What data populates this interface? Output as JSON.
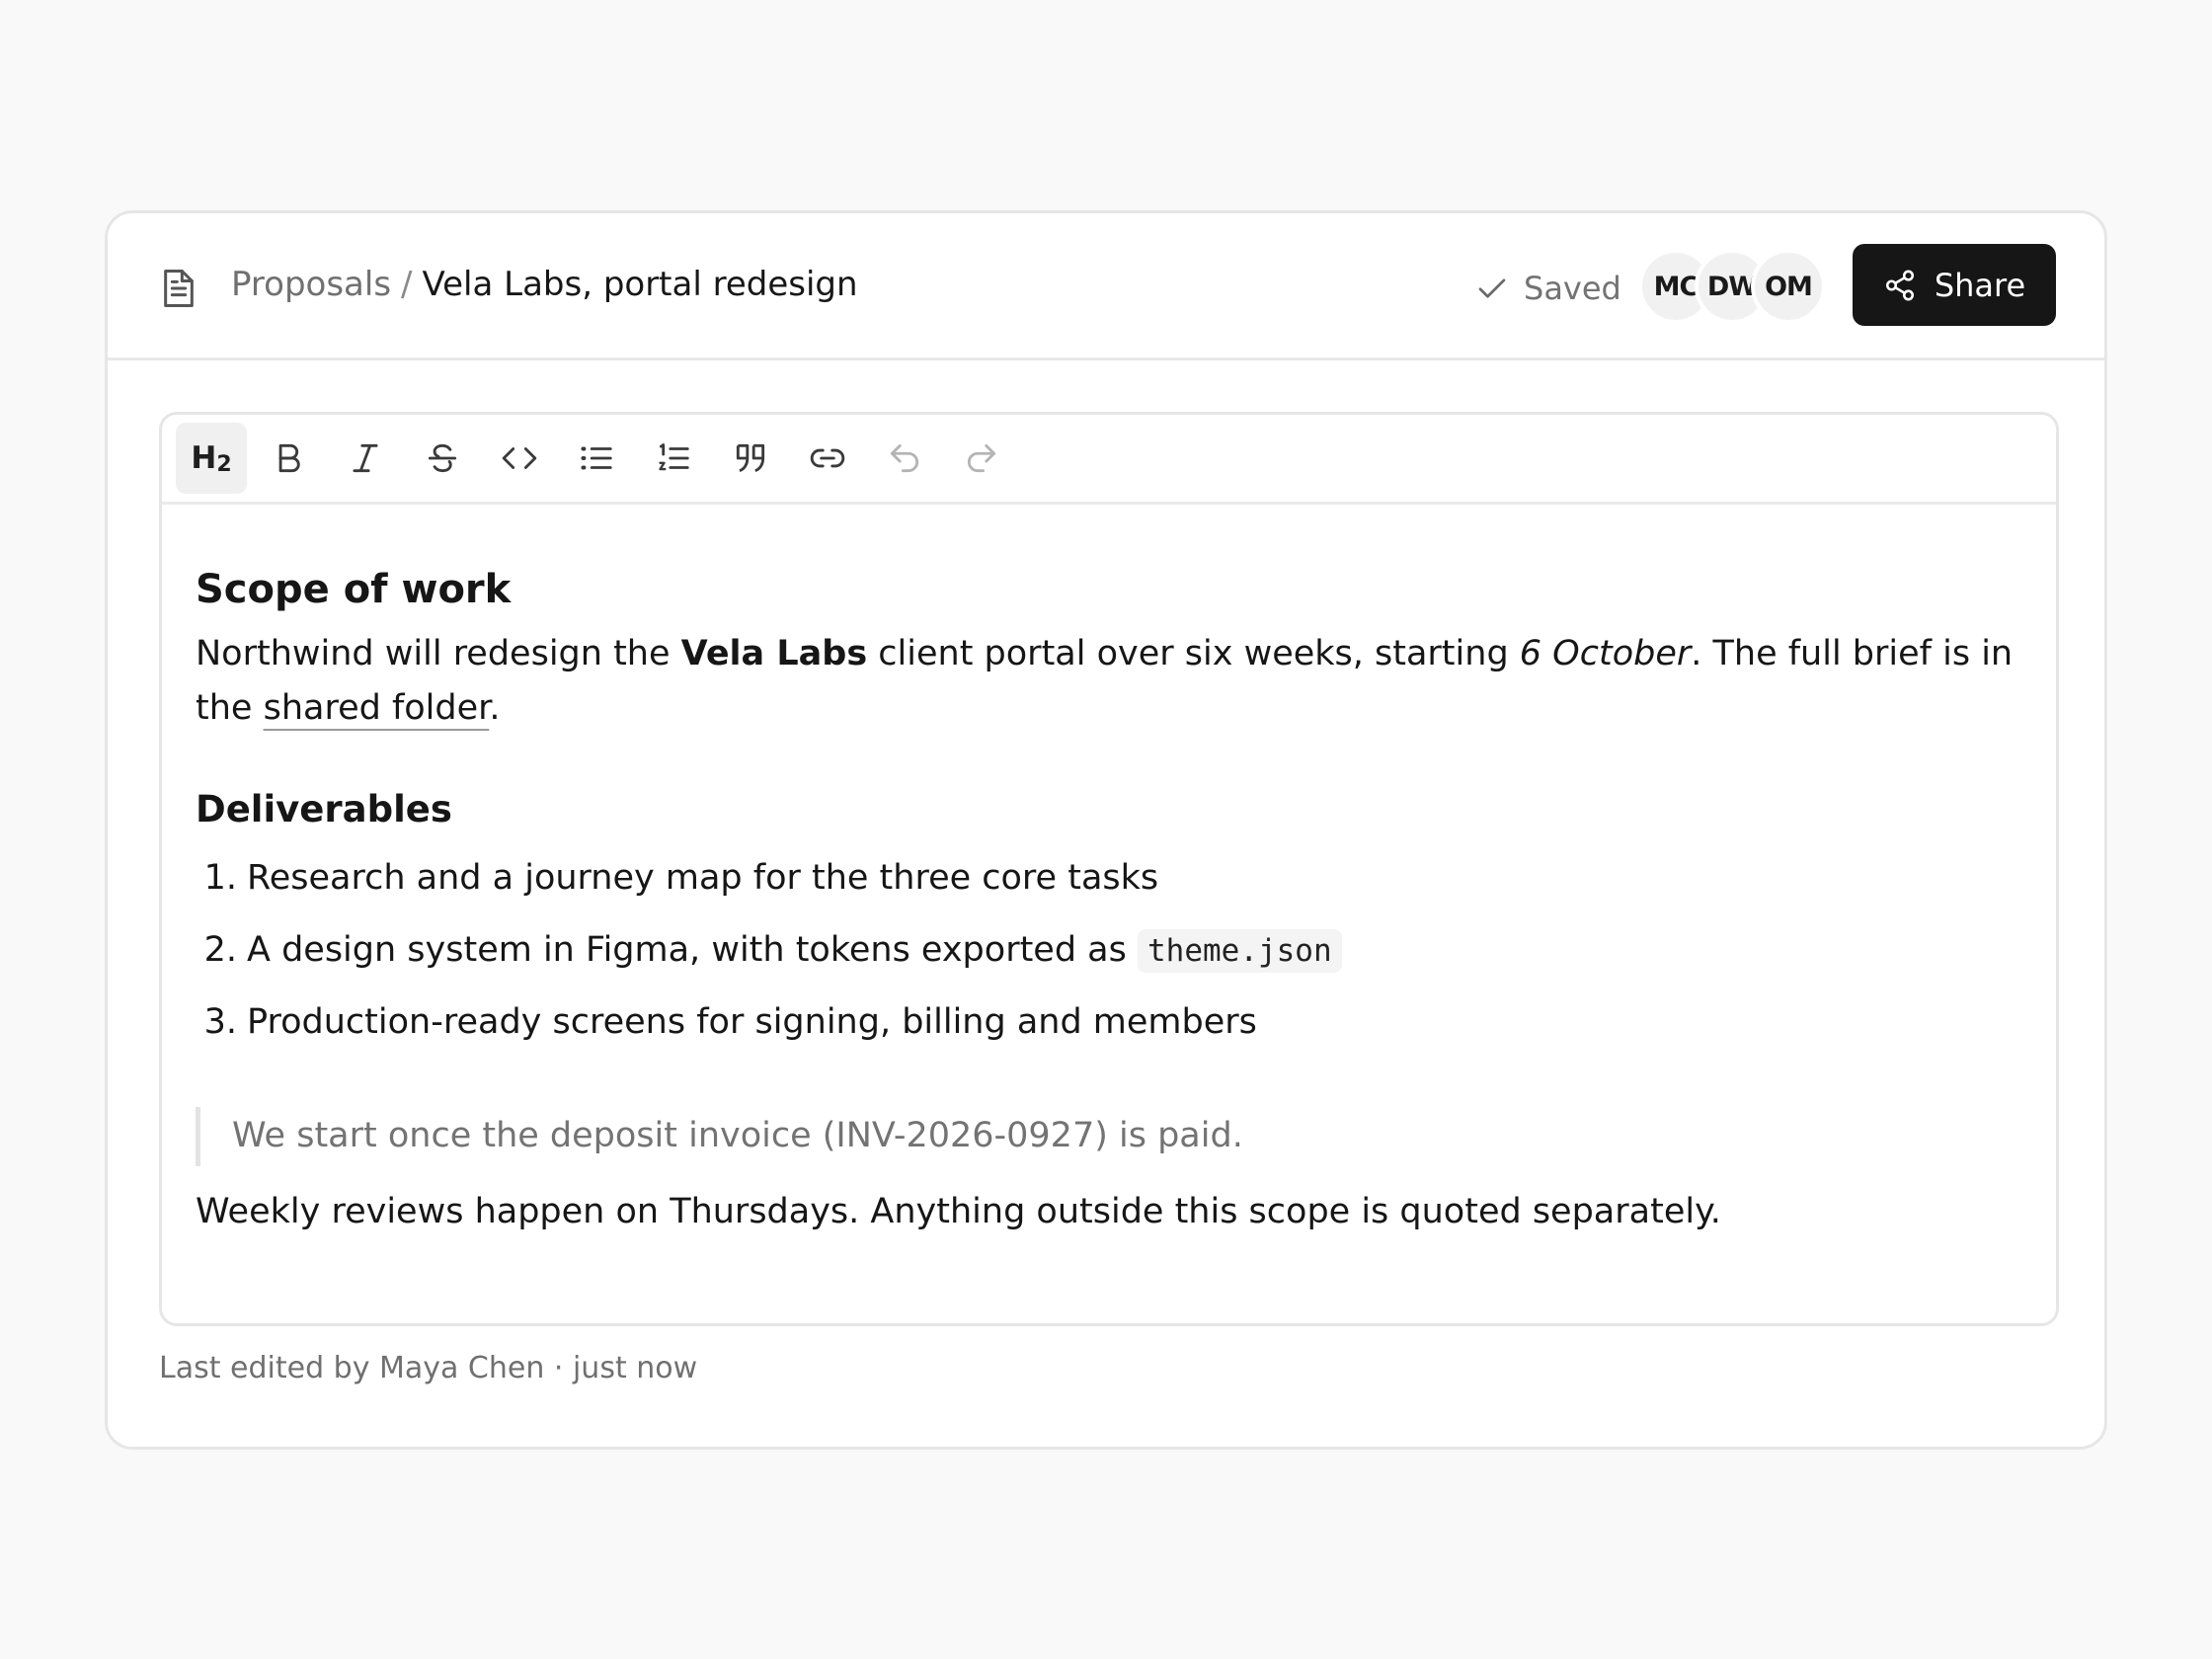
{
  "header": {
    "breadcrumb_parent": "Proposals",
    "breadcrumb_separator": "/",
    "breadcrumb_current": "Vela Labs, portal redesign",
    "status": "Saved",
    "collaborators": [
      "MC",
      "DW",
      "OM"
    ],
    "share_label": "Share"
  },
  "toolbar": {
    "heading_main": "H",
    "heading_level": "2",
    "tools": [
      "heading-2",
      "bold",
      "italic",
      "strikethrough",
      "code",
      "bullet-list",
      "ordered-list",
      "blockquote",
      "link",
      "undo",
      "redo"
    ]
  },
  "document": {
    "heading_scope": "Scope of work",
    "para_1": "Northwind will redesign the ",
    "para_bold": "Vela Labs",
    "para_2": " client portal over six weeks, starting ",
    "para_italic": "6 October",
    "para_3": ". The full brief is in the ",
    "para_link": "shared folder",
    "para_4": ".",
    "heading_deliverables": "Deliverables",
    "items": [
      {
        "num": "1.",
        "text": "Research and a journey map for the three core tasks"
      },
      {
        "num": "2.",
        "text": "A design system in Figma, with tokens exported as ",
        "code": "theme.json"
      },
      {
        "num": "3.",
        "text": "Production-ready screens for signing, billing and members"
      }
    ],
    "quote": "We start once the deposit invoice (INV-2026-0927) is paid.",
    "closing": "Weekly reviews happen on Thursdays. Anything outside this scope is quoted separately."
  },
  "footer": {
    "last_edited": "Last edited by Maya Chen · just now"
  },
  "colors": {
    "page_background": "#f9f9f9",
    "share_button": "#161616",
    "text": "#171717",
    "muted_text": "#707070"
  }
}
